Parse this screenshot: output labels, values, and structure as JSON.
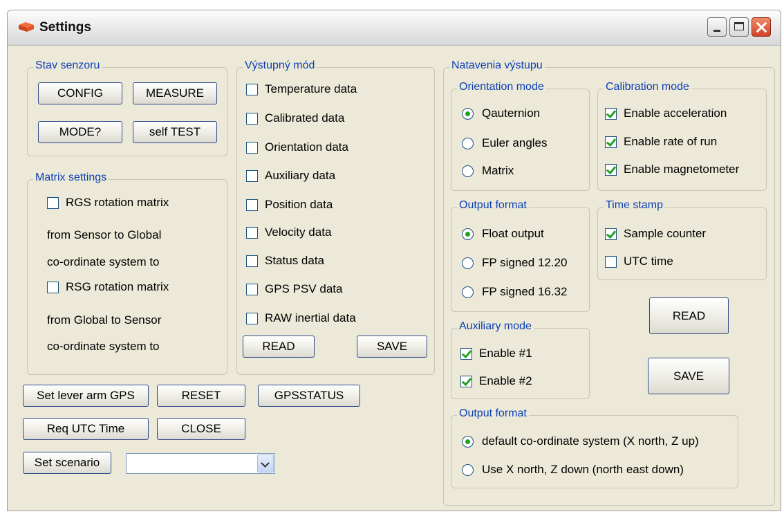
{
  "window": {
    "title": "Settings"
  },
  "stav_senzoru": {
    "label": "Stav senzoru",
    "buttons": [
      "CONFIG",
      "MEASURE",
      "MODE?",
      "self TEST"
    ]
  },
  "matrix_settings": {
    "label": "Matrix settings",
    "lines": [
      {
        "checkbox": true,
        "checked": false,
        "text": "RGS rotation matrix"
      },
      {
        "checkbox": false,
        "text": "from Sensor to Global"
      },
      {
        "checkbox": false,
        "text": "co-ordinate system to"
      },
      {
        "checkbox": true,
        "checked": false,
        "text": "RSG rotation matrix"
      },
      {
        "checkbox": false,
        "text": "from Global to Sensor"
      },
      {
        "checkbox": false,
        "text": "co-ordinate system to"
      }
    ]
  },
  "vystupny_mod": {
    "label": "Výstupný mód",
    "items": [
      {
        "label": "Temperature data",
        "checked": false
      },
      {
        "label": "Calibrated data",
        "checked": false
      },
      {
        "label": "Orientation data",
        "checked": false
      },
      {
        "label": "Auxiliary data",
        "checked": false
      },
      {
        "label": "Position data",
        "checked": false
      },
      {
        "label": "Velocity data",
        "checked": false
      },
      {
        "label": "Status data",
        "checked": false
      },
      {
        "label": "GPS PSV data",
        "checked": false
      },
      {
        "label": "RAW inertial data",
        "checked": false
      }
    ],
    "read_label": "READ",
    "save_label": "SAVE"
  },
  "bottom_buttons": {
    "set_lever_arm": "Set lever arm GPS",
    "reset": "RESET",
    "gpsstatus": "GPSSTATUS",
    "req_utc": "Req UTC Time",
    "close": "CLOSE",
    "set_scenario": "Set scenario",
    "scenario_value": ""
  },
  "natavenia": {
    "label": "Natavenia výstupu",
    "orientation_mode": {
      "label": "Orientation mode",
      "options": [
        {
          "label": "Qauternion",
          "selected": true
        },
        {
          "label": "Euler angles",
          "selected": false
        },
        {
          "label": "Matrix",
          "selected": false
        }
      ]
    },
    "calibration_mode": {
      "label": "Calibration mode",
      "items": [
        {
          "label": "Enable acceleration",
          "checked": true
        },
        {
          "label": "Enable rate of run",
          "checked": true
        },
        {
          "label": "Enable magnetometer",
          "checked": true
        }
      ]
    },
    "output_format": {
      "label": "Output format",
      "options": [
        {
          "label": "Float output",
          "selected": true
        },
        {
          "label": "FP signed 12.20",
          "selected": false
        },
        {
          "label": "FP signed 16.32",
          "selected": false
        }
      ]
    },
    "time_stamp": {
      "label": "Time stamp",
      "items": [
        {
          "label": "Sample counter",
          "checked": true
        },
        {
          "label": "UTC time",
          "checked": false
        }
      ]
    },
    "read_label": "READ",
    "save_label": "SAVE",
    "auxiliary_mode": {
      "label": "Auxiliary mode",
      "items": [
        {
          "label": "Enable #1",
          "checked": true
        },
        {
          "label": "Enable #2",
          "checked": true
        }
      ]
    },
    "output_format2": {
      "label": "Output format",
      "options": [
        {
          "label": "default co-ordinate system (X north, Z up)",
          "selected": true
        },
        {
          "label": "Use X north, Z down (north east down)",
          "selected": false
        }
      ]
    }
  }
}
